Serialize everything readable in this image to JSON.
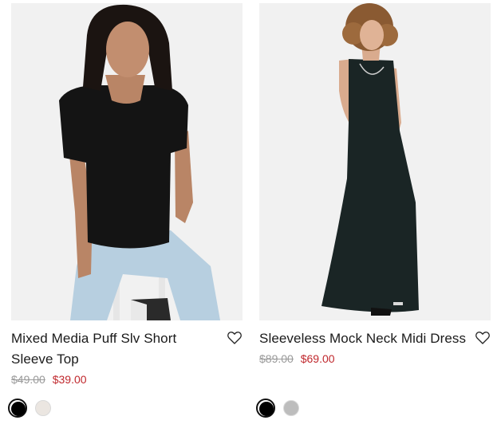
{
  "products": [
    {
      "name": "Mixed Media Puff Slv Short Sleeve Top",
      "image_alt": "Model wearing black mixed media puff sleeve top with light jeans",
      "price_original": "$49.00",
      "price_sale": "$39.00",
      "swatches": [
        {
          "color_name": "black",
          "hex": "#000000",
          "selected": true
        },
        {
          "color_name": "ivory",
          "hex": "#ebe6e1",
          "selected": false
        }
      ]
    },
    {
      "name": "Sleeveless Mock Neck Midi Dress",
      "image_alt": "Model wearing black sleeveless mock neck midi dress",
      "price_original": "$89.00",
      "price_sale": "$69.00",
      "swatches": [
        {
          "color_name": "black",
          "hex": "#000000",
          "selected": true
        },
        {
          "color_name": "grey",
          "hex": "#bdbdbd",
          "selected": false
        }
      ]
    }
  ],
  "icons": {
    "wishlist": "heart-outline-icon"
  },
  "colors": {
    "sale_price": "#c0282d",
    "original_price": "#9a9a9a",
    "text": "#1a1a1a"
  }
}
